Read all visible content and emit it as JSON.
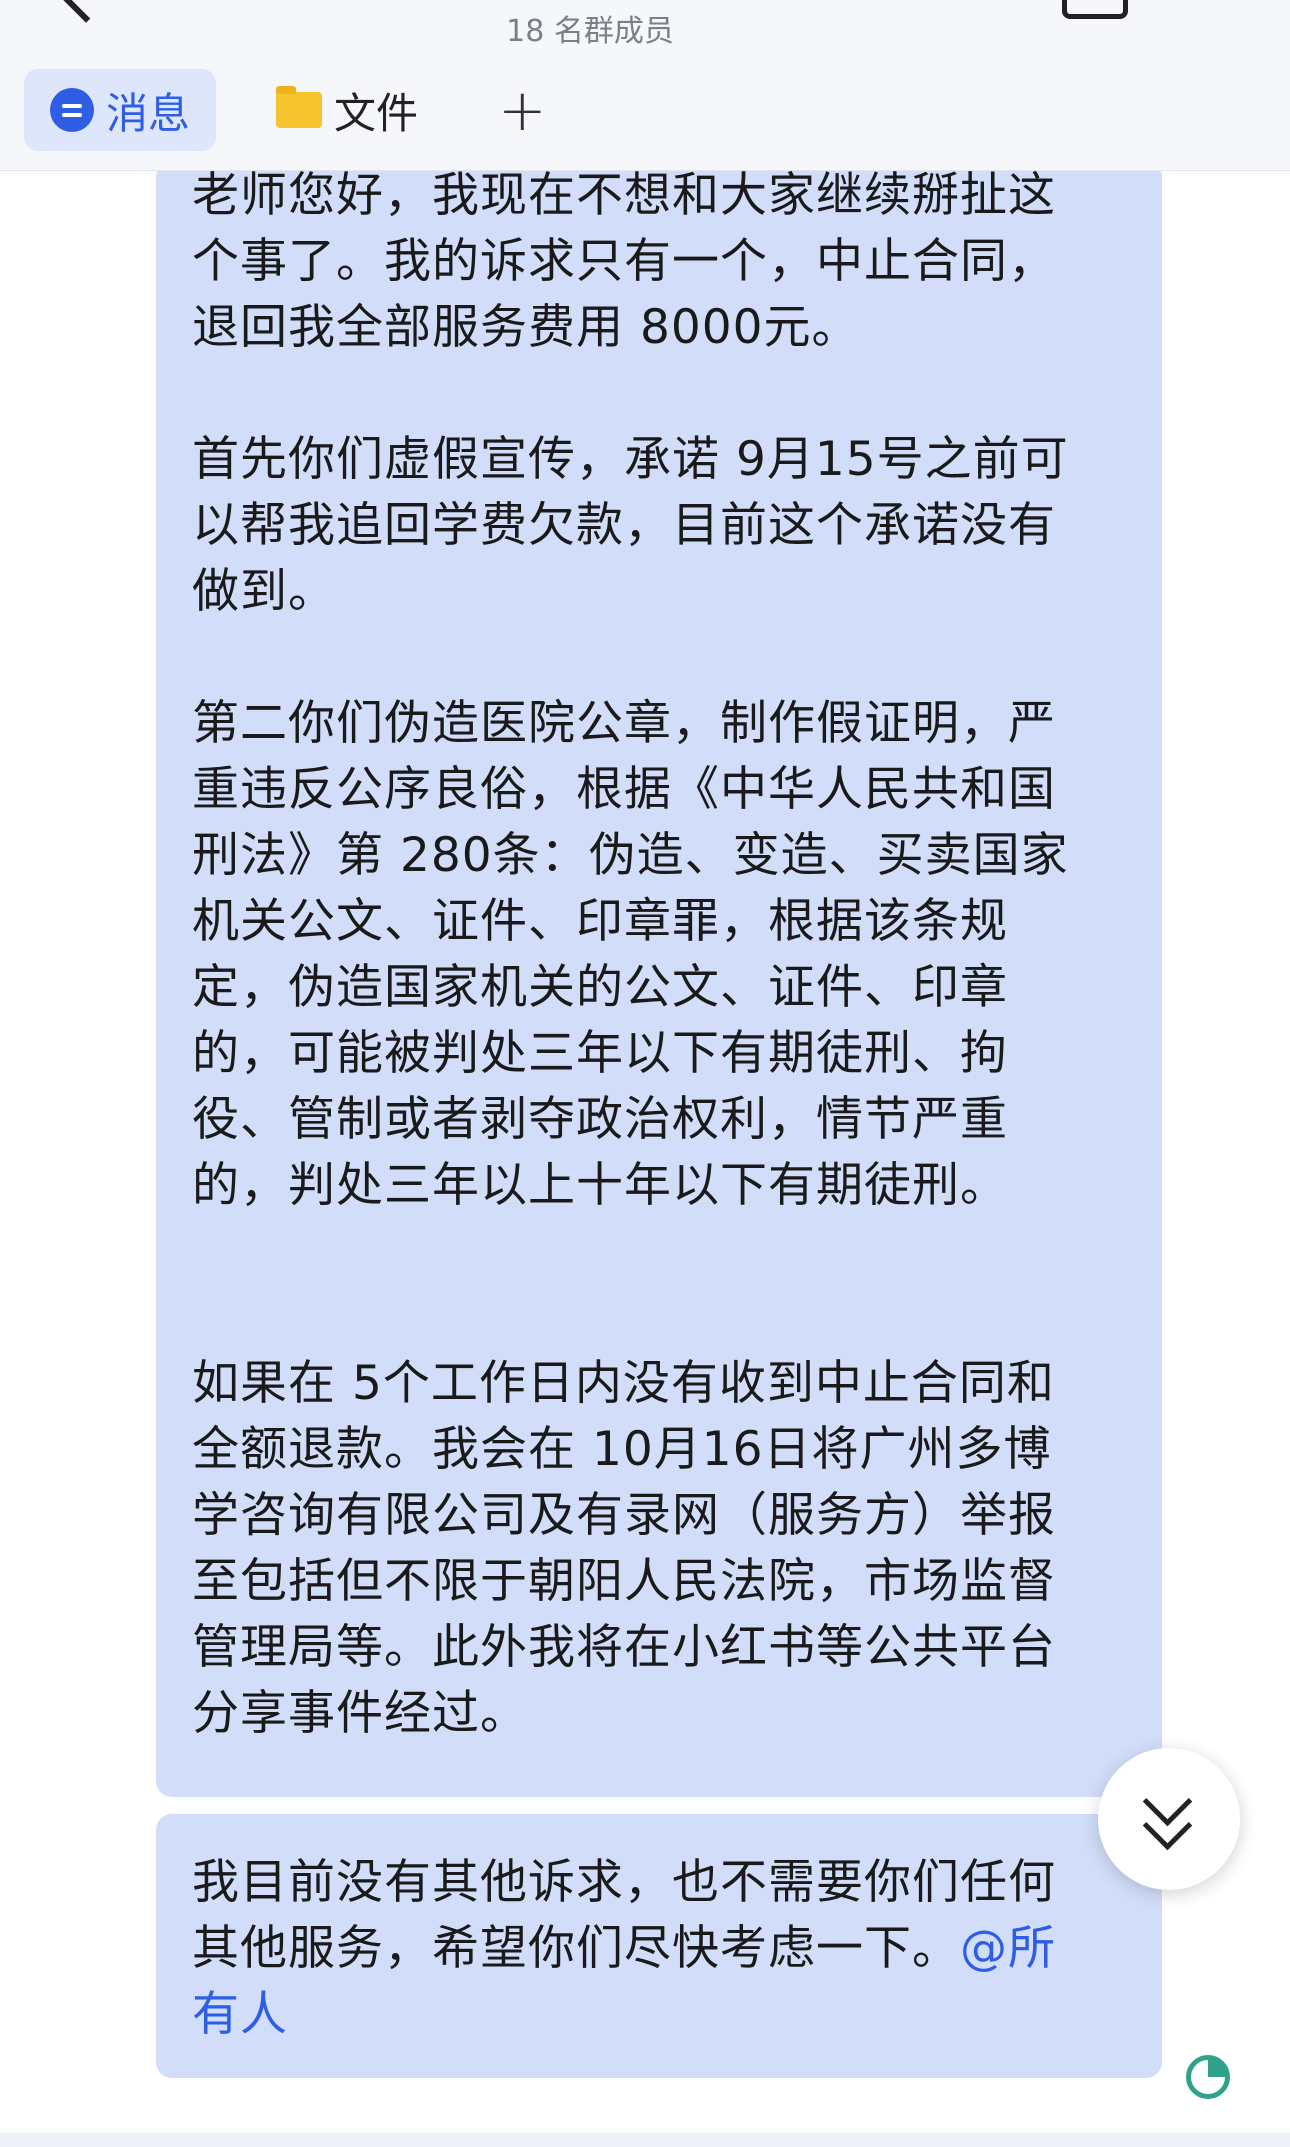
{
  "header": {
    "member_count": "18 名群成员"
  },
  "tabs": [
    {
      "label": "消息",
      "icon": "message-icon",
      "active": true
    },
    {
      "label": "文件",
      "icon": "folder-icon",
      "active": false
    }
  ],
  "add_tab_glyph": "+",
  "messages": [
    {
      "paragraphs": [
        "老师您好，我现在不想和大家继续掰扯这\n个事了。我的诉求只有一个，中止合同，\n退回我全部服务费用 8000元。",
        "首先你们虚假宣传，承诺 9月15号之前可\n以帮我追回学费欠款，目前这个承诺没有\n做到。",
        "第二你们伪造医院公章，制作假证明，严\n重违反公序良俗，根据《中华人民共和国\n刑法》第 280条：伪造、变造、买卖国家\n机关公文、证件、印章罪，根据该条规\n定，伪造国家机关的公文、证件、印章\n的，可能被判处三年以下有期徒刑、拘\n役、管制或者剥夺政治权利，情节严重\n的，判处三年以上十年以下有期徒刑。",
        "如果在 5个工作日内没有收到中止合同和\n全额退款。我会在 10月16日将广州多博\n学咨询有限公司及有录网（服务方）举报\n至包括但不限于朝阳人民法院，市场监督\n管理局等。此外我将在小红书等公共平台\n分享事件经过。"
      ]
    },
    {
      "text": "我目前没有其他诉求，也不需要你们任何\n其他服务，希望你们尽快考虑一下。",
      "mention": "@所\n有人"
    }
  ],
  "colors": {
    "bubble": "#d2def9",
    "accent": "#2f5de3",
    "read_status": "#2fa38a"
  }
}
